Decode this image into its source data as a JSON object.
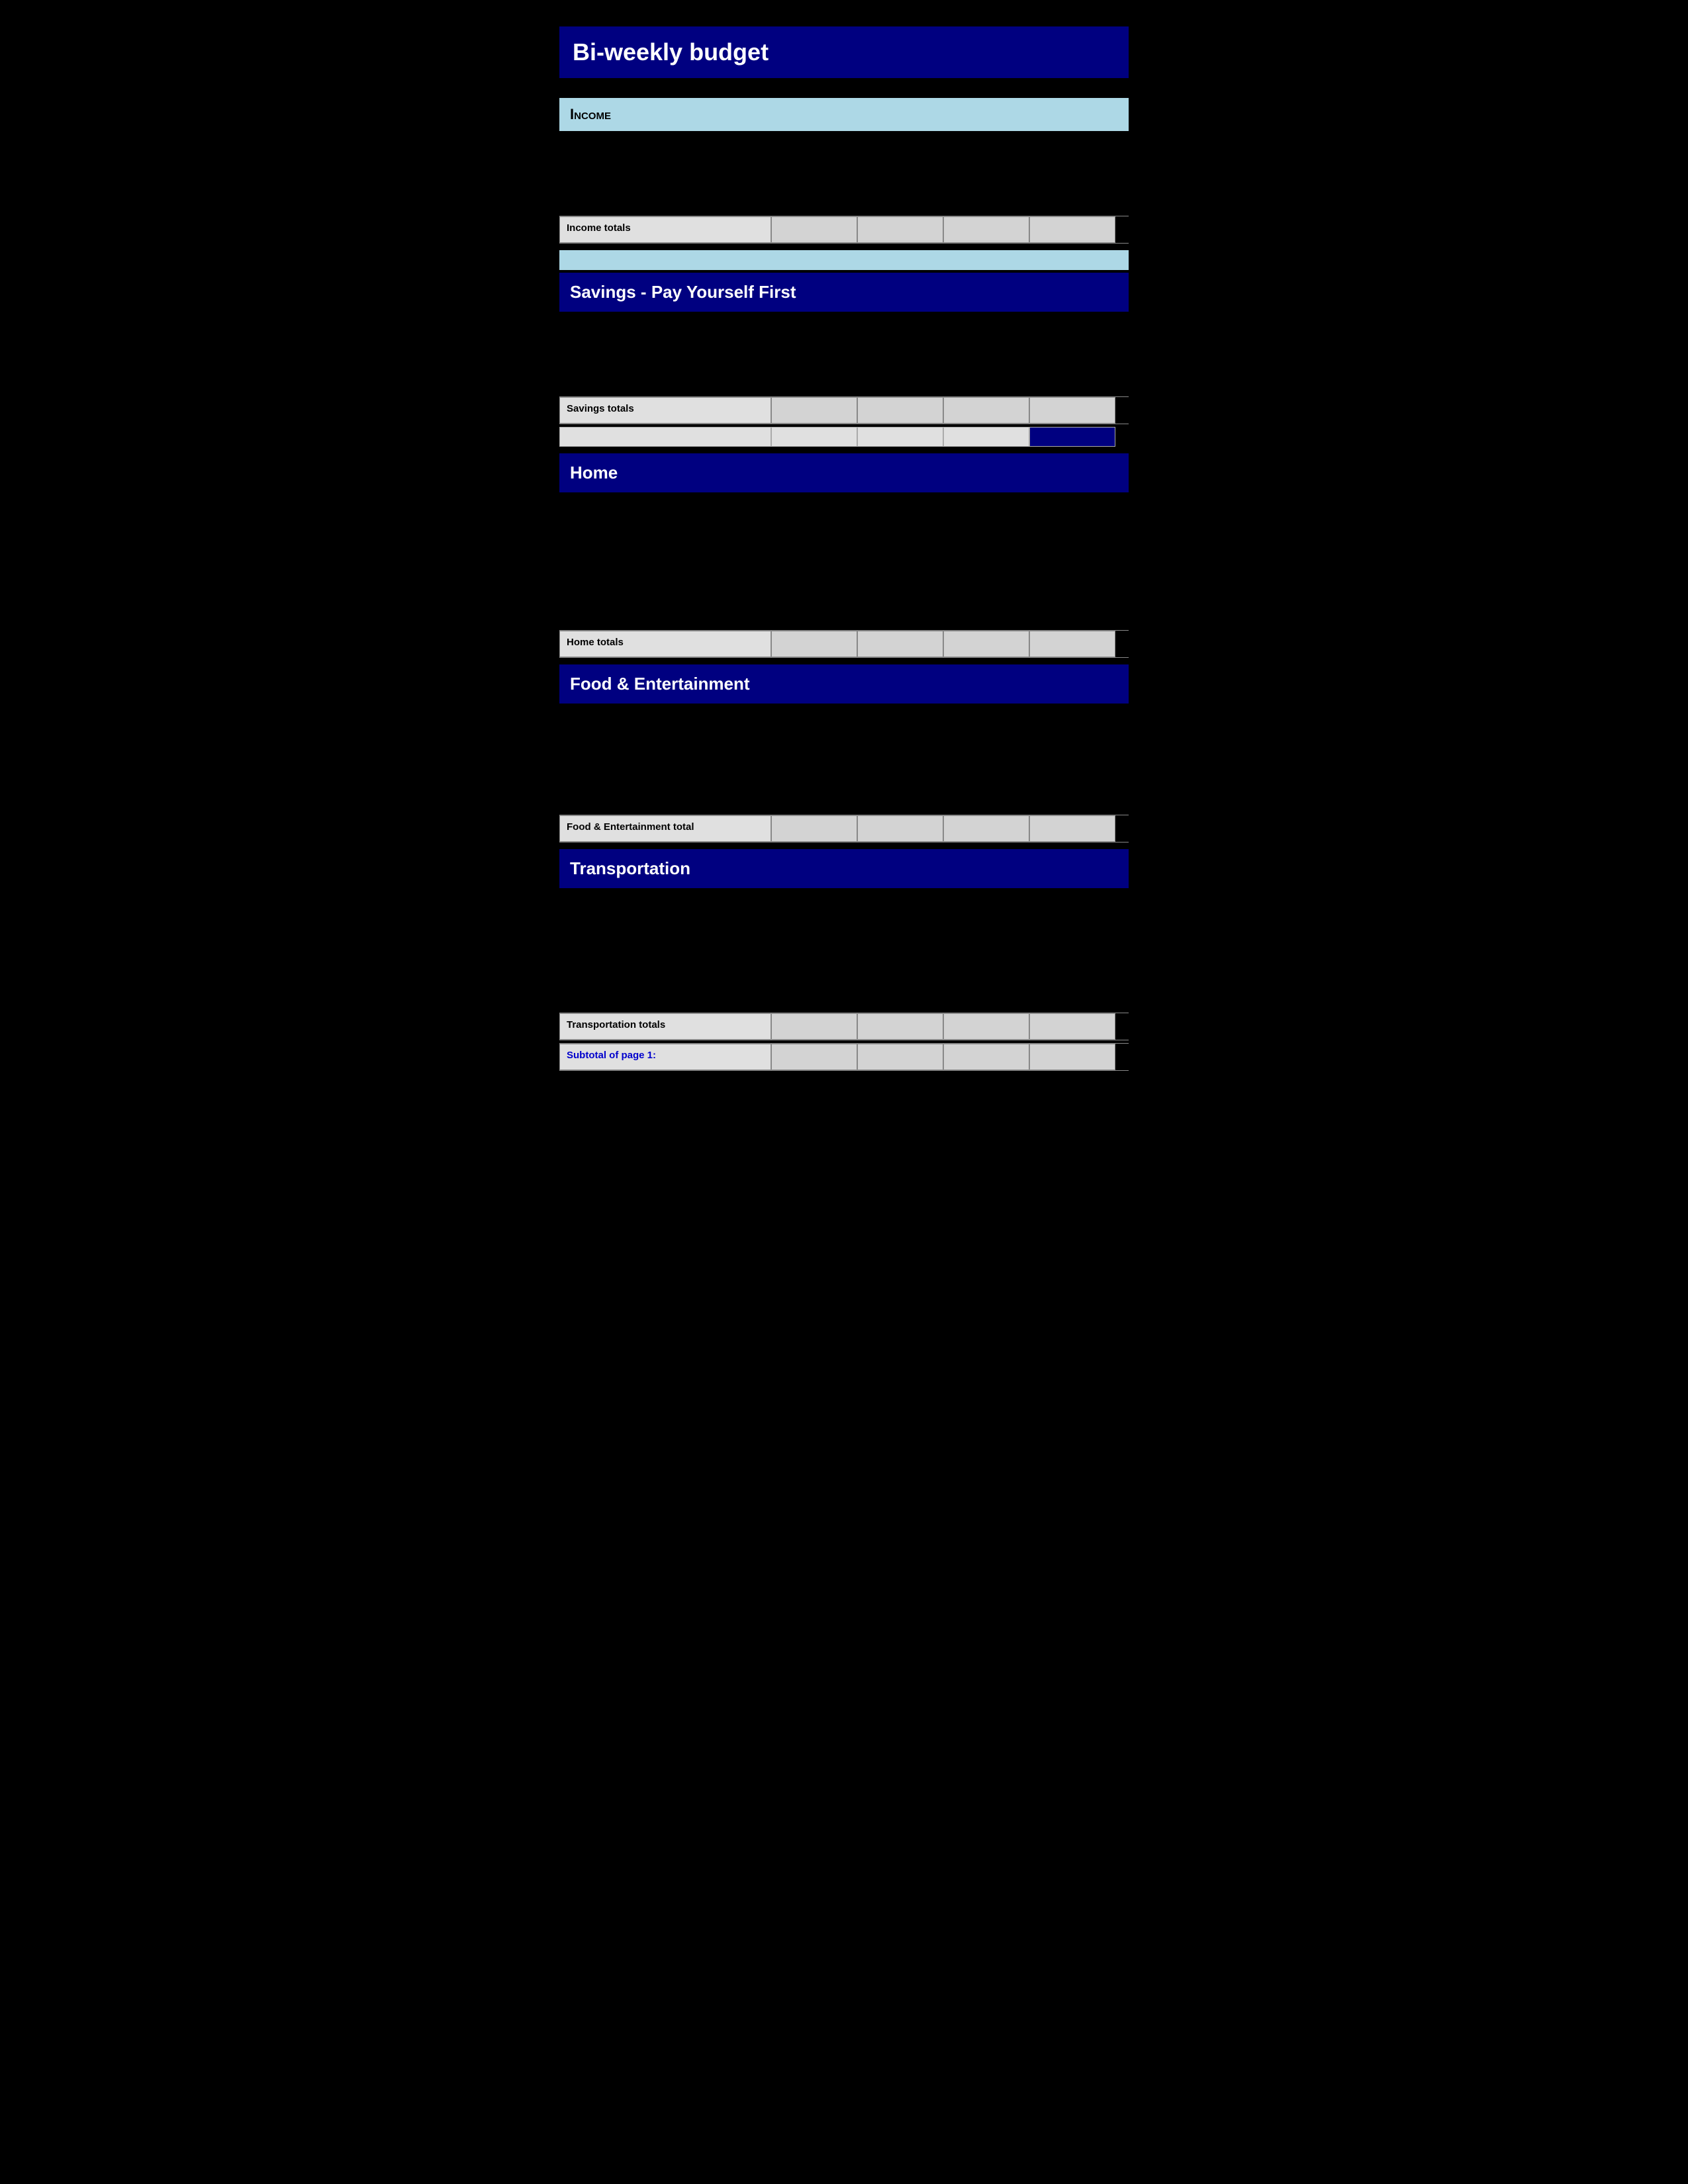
{
  "page": {
    "title": "Bi-weekly  budget",
    "sections": {
      "income": {
        "header": "Income",
        "totals_label": "Income totals"
      },
      "savings": {
        "header": "Savings - Pay Yourself First",
        "totals_label": "Savings totals"
      },
      "home": {
        "header": "Home",
        "totals_label": "Home totals"
      },
      "food": {
        "header": "Food & Entertainment",
        "totals_label": "Food & Entertainment total"
      },
      "transportation": {
        "header": "Transportation",
        "totals_label": "Transportation totals"
      },
      "subtotal": {
        "label": "Subtotal of page 1:"
      }
    }
  }
}
